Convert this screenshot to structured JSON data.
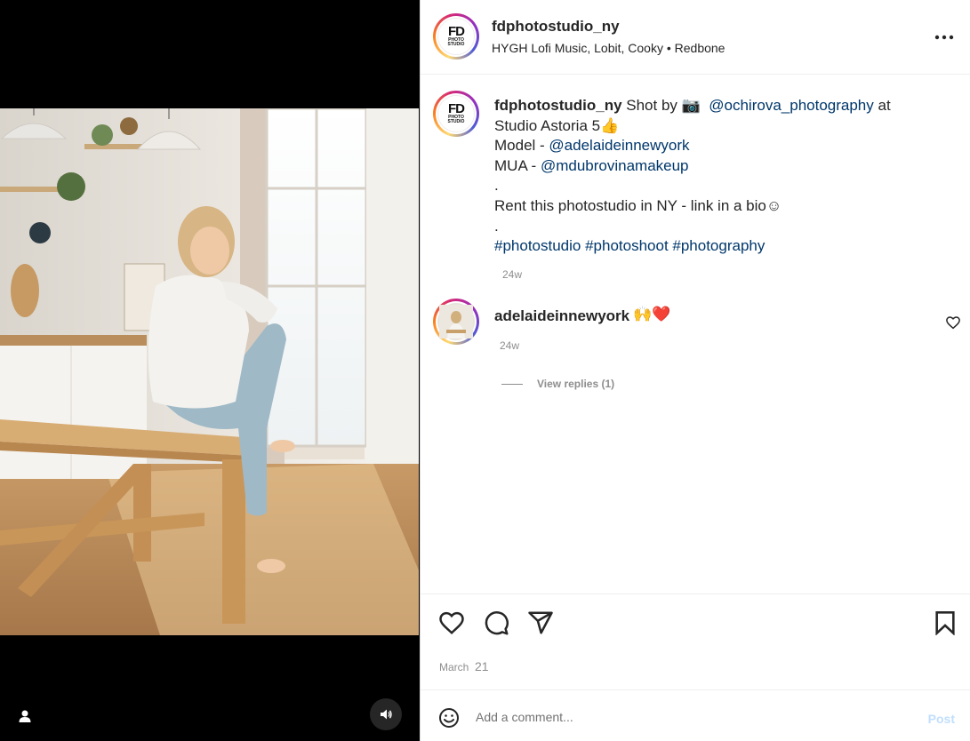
{
  "post": {
    "username": "fdphotostudio_ny",
    "music": "HYGH Lofi Music, Lobit, Cooky • Redbone",
    "avatar_logo": {
      "big": "FD",
      "small1": "PHOTO",
      "small2": "STUDIO"
    }
  },
  "caption": {
    "username": "fdphotostudio_ny",
    "line1_pre": " Shot by ",
    "camera_emoji": "📷",
    "photographer": "@ochirova_photography",
    "line1_post": " at",
    "line2": "Studio Astoria 5👍",
    "model_label": "Model - ",
    "model": "@adelaideinnewyork",
    "mua_label": "MUA - ",
    "mua": "@mdubrovinamakeup",
    "dot1": ".",
    "rent": "Rent this photostudio in NY - link in a bio☺",
    "dot2": ".",
    "hashtags": "#photostudio #photoshoot #photography",
    "time": "24w"
  },
  "comment": {
    "username": "adelaideinnewyork",
    "text": "🙌❤️",
    "time": "24w",
    "view_replies": "View replies (1)"
  },
  "actions": {
    "like_icon": "heart-icon",
    "comment_icon": "comment-icon",
    "share_icon": "send-icon",
    "save_icon": "bookmark-icon",
    "date_month": "March",
    "date_day": "21"
  },
  "add_comment": {
    "placeholder": "Add a comment...",
    "post_label": "Post"
  },
  "colors": {
    "link": "#00376b",
    "muted": "#8e8e8e",
    "post_disabled": "#c0dffd",
    "like_red": "#ed4956"
  }
}
